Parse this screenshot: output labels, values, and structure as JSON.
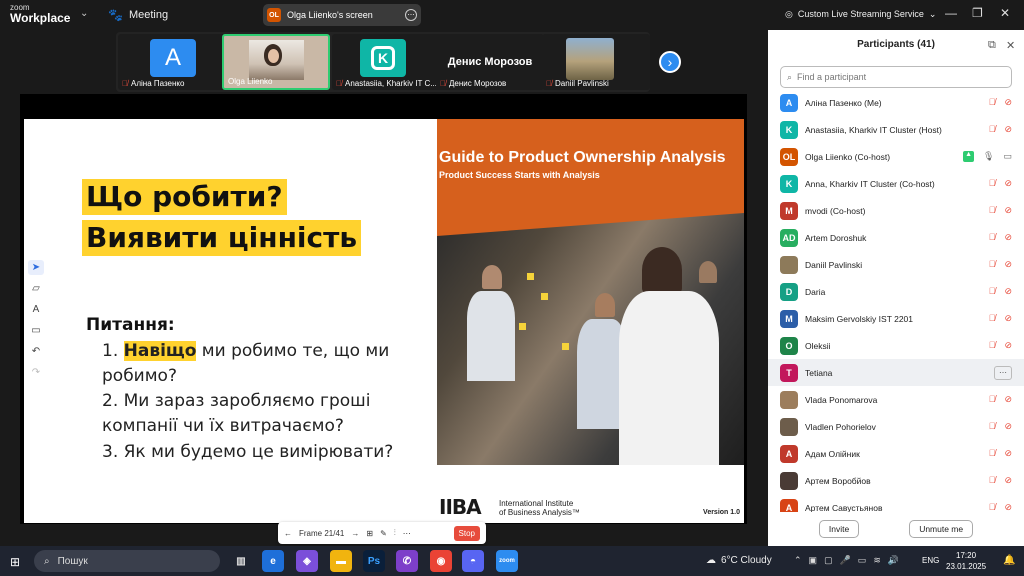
{
  "app": {
    "brand_small": "zoom",
    "brand_big": "Workplace",
    "meeting_label": "Meeting",
    "screen_badge": "OL",
    "screen_title": "Olga Liienko's screen",
    "stream_label": "Custom Live Streaming Service"
  },
  "videos": {
    "tiles": [
      {
        "name": "Аліна Пазенко",
        "avatar": "A"
      },
      {
        "name": "Olga Liienko"
      },
      {
        "name": "Anastasiia, Kharkiv IT C...",
        "avatar": "K"
      },
      {
        "name": "Денис Морозов",
        "center": "Денис Морозов"
      },
      {
        "name": "Daniil Pavlinski"
      }
    ]
  },
  "slide": {
    "heading1": "Що робити?",
    "heading2": "Виявити цінність",
    "questions_title": "Питання:",
    "q1_num": "1.",
    "q1_mark": "Навіщо",
    "q1_rest": " ми робимо те, що ми робимо?",
    "q2": "2. Ми зараз заробляємо гроші компанії чи їх витрачаємо?",
    "q3": "3. Як ми будемо це вимірювати?",
    "cover_title": "Guide to Product Ownership Analysis",
    "cover_subtitle": "Product Success Starts with Analysis",
    "iiba_logo": "IIBA",
    "iiba_line1": "International Institute",
    "iiba_line2": "of Business Analysis™",
    "version": "Version 1.0"
  },
  "share_bar": {
    "frame": "Frame 21/41",
    "stop": "Stop"
  },
  "panel": {
    "title": "Participants (41)",
    "search_placeholder": "Find a participant",
    "participants": [
      {
        "name": "Аліна Пазенко (Me)",
        "avatar": "A",
        "color": "#2d8cf0"
      },
      {
        "name": "Anastasiia, Kharkiv IT Cluster (Host)",
        "avatar": "K",
        "color": "#0fb6a6"
      },
      {
        "name": "Olga Liienko (Co-host)",
        "avatar": "OL",
        "color": "#d35400"
      },
      {
        "name": "Anna, Kharkiv IT Cluster (Co-host)",
        "avatar": "K",
        "color": "#0fb6a6"
      },
      {
        "name": "mvodi (Co-host)",
        "avatar": "M",
        "color": "#c0392b"
      },
      {
        "name": "Artem Doroshuk",
        "avatar": "AD",
        "color": "#27ae60"
      },
      {
        "name": "Daniil Pavlinski",
        "avatar": "",
        "color": "#8d7a5a"
      },
      {
        "name": "Daria",
        "avatar": "D",
        "color": "#16a085"
      },
      {
        "name": "Maksim Gervolskiy IST 2201",
        "avatar": "M",
        "color": "#2c5ea8"
      },
      {
        "name": "Oleksii",
        "avatar": "O",
        "color": "#1e8449"
      },
      {
        "name": "Tetiana",
        "avatar": "T",
        "color": "#c2185b"
      },
      {
        "name": "Vlada Ponomarova",
        "avatar": "",
        "color": "#9c7d5c"
      },
      {
        "name": "Vladlen Pohorielov",
        "avatar": "",
        "color": "#6d5d4b"
      },
      {
        "name": "Адам Олійник",
        "avatar": "А",
        "color": "#c0392b"
      },
      {
        "name": "Артем Воробйов",
        "avatar": "",
        "color": "#4a3b35"
      },
      {
        "name": "Артем Савустьянов",
        "avatar": "А",
        "color": "#d84315"
      }
    ],
    "invite": "Invite",
    "unmute": "Unmute me"
  },
  "taskbar": {
    "search": "Пошук",
    "weather": "6°C  Cloudy",
    "lang": "ENG",
    "time": "17:20",
    "date": "23.01.2025"
  },
  "colors": {
    "accent": "#2d8cf0",
    "highlight": "#ffd22e",
    "cover_orange": "#d6601d",
    "muted_red": "#e74c3c"
  }
}
